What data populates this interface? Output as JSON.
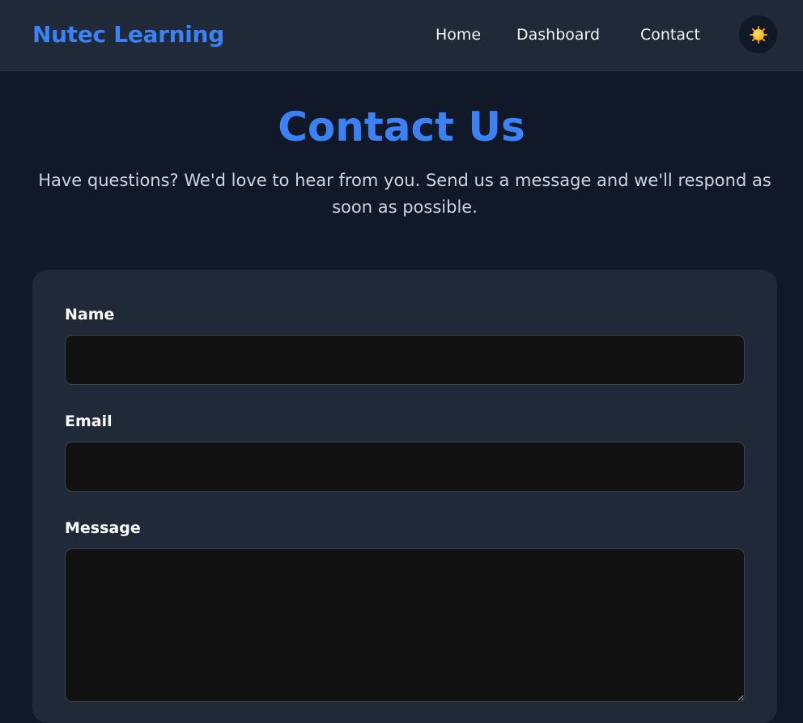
{
  "header": {
    "brand": "Nutec Learning",
    "nav": [
      {
        "label": "Home"
      },
      {
        "label": "Dashboard"
      },
      {
        "label": "Contact"
      }
    ],
    "theme_toggle_icon": "sun-icon"
  },
  "main": {
    "title": "Contact Us",
    "subtitle": "Have questions? We'd love to hear from you. Send us a message and we'll respond as soon as possible."
  },
  "form": {
    "name_label": "Name",
    "name_value": "",
    "email_label": "Email",
    "email_value": "",
    "message_label": "Message",
    "message_value": ""
  },
  "colors": {
    "background": "#111827",
    "surface": "#1f2937",
    "accent": "#3b82f6",
    "input_bg": "#121212"
  }
}
